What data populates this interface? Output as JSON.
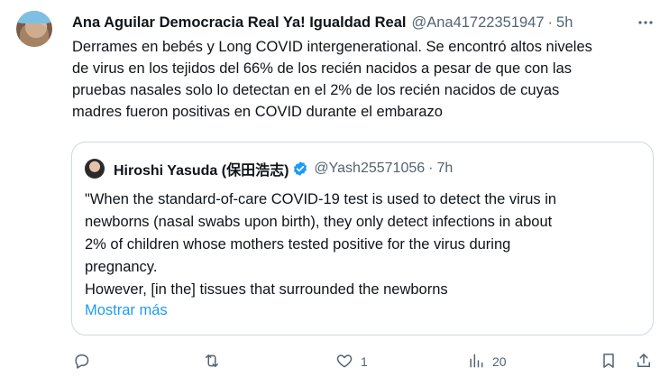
{
  "author": {
    "name": "Ana Aguilar Democracia Real Ya! Igualdad Real",
    "handle": "@Ana41722351947",
    "separator": "·",
    "time": "5h"
  },
  "tweet": {
    "lines": [
      "Derrames en bebés y Long COVID intergenerational. Se encontró altos niveles",
      "de virus en los tejidos del 66% de los recién nacidos a pesar de que con las",
      "pruebas nasales solo lo detectan en el 2% de los recién nacidos de cuyas",
      "madres fueron positivas en COVID durante el embarazo"
    ]
  },
  "quote": {
    "name": "Hiroshi Yasuda (保田浩志)",
    "handle": "@Yash25571056",
    "separator": "·",
    "time": "7h",
    "lines": [
      "\"When the standard-of-care COVID-19 test is used to detect the virus in",
      "newborns (nasal swabs upon birth), they only detect infections in about",
      "2% of children whose mothers tested positive for the virus during",
      "pregnancy.",
      "However, [in the] tissues that surrounded the newborns"
    ],
    "show_more": "Mostrar más",
    "verified_color": "#1d9bf0"
  },
  "actions": {
    "reply_count": "",
    "retweet_count": "",
    "like_count": "1",
    "views_count": "20"
  },
  "icons": [
    "reply-icon",
    "retweet-icon",
    "like-icon",
    "views-icon",
    "bookmark-icon",
    "share-icon",
    "more-icon",
    "verified-icon"
  ],
  "colors": {
    "text": "#0f1419",
    "secondary": "#536471",
    "link": "#1d9bf0",
    "border": "#cfd9de"
  }
}
